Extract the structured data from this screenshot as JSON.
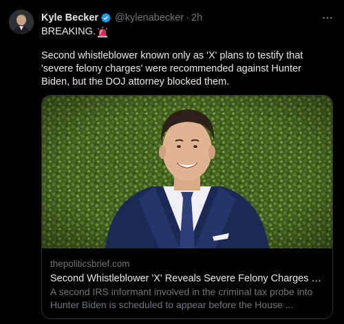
{
  "tweet": {
    "author_name": "Kyle Becker",
    "handle": "@kylenabecker",
    "separator": "·",
    "time": "2h",
    "first_line": "BREAKING.",
    "body": "Second whistleblower known only as 'X' plans to testify that 'severe felony charges' were recommended against Hunter Biden, but the DOJ attorney blocked them."
  },
  "card": {
    "domain": "thepoliticsbrief.com",
    "title": "Second Whistleblower 'X' Reveals Severe Felony Charges W...",
    "description": "A second IRS informant involved in the criminal tax probe into Hunter Biden is scheduled to appear before the House ..."
  },
  "icons": {
    "verified": "verified-badge-icon",
    "siren": "police-light-emoji",
    "more": "more-horizontal-icon"
  },
  "colors": {
    "background": "#000000",
    "primary_text": "#e7e9ea",
    "secondary_text": "#71767b",
    "verified_blue": "#1d9bf0",
    "card_border": "#2f3336"
  }
}
